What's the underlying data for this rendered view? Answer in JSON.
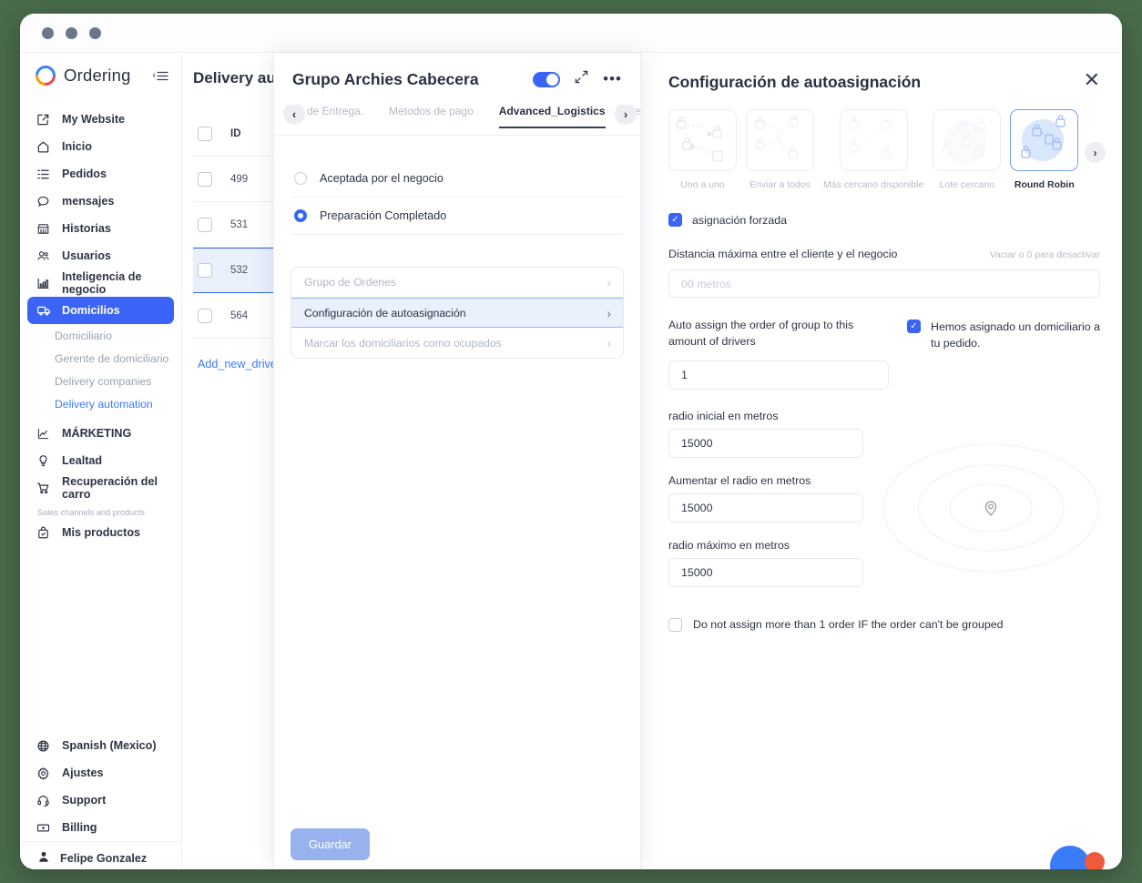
{
  "theme": {
    "accent": "#3b64f6",
    "link": "#3b7bf6",
    "desktop_bg": "#4a6b4c"
  },
  "sidebar": {
    "brand": "Ordering",
    "collapse_icon": "collapse-menu-icon",
    "items": [
      {
        "label": "My Website",
        "icon": "external-link-icon"
      },
      {
        "label": "Inicio",
        "icon": "home-icon"
      },
      {
        "label": "Pedidos",
        "icon": "list-icon"
      },
      {
        "label": "mensajes",
        "icon": "chat-bubble-icon"
      },
      {
        "label": "Historias",
        "icon": "store-icon"
      },
      {
        "label": "Usuarios",
        "icon": "users-icon"
      },
      {
        "label": "Inteligencia de negocio",
        "icon": "bar-chart-icon"
      },
      {
        "label": "Domicilios",
        "icon": "truck-icon",
        "active": true
      }
    ],
    "sub_items": [
      {
        "label": "Domiciliario",
        "selected": false
      },
      {
        "label": "Gerente de domiciliario",
        "selected": false
      },
      {
        "label": "Delivery companies",
        "selected": false
      },
      {
        "label": "Delivery automation",
        "selected": true
      }
    ],
    "items2": [
      {
        "label": "MÁRKETING",
        "icon": "trending-up-icon"
      },
      {
        "label": "Lealtad",
        "icon": "lightbulb-icon"
      },
      {
        "label": "Recuperación del carro",
        "icon": "shopping-cart-icon"
      }
    ],
    "group_label": "Sales channels and products",
    "items3": [
      {
        "label": "Mis productos",
        "icon": "bag-check-icon"
      }
    ],
    "bottom_items": [
      {
        "label": "Spanish (Mexico)",
        "icon": "globe-icon"
      },
      {
        "label": "Ajustes",
        "icon": "gear-icon"
      },
      {
        "label": "Support",
        "icon": "headset-icon"
      },
      {
        "label": "Billing",
        "icon": "banknote-icon"
      }
    ],
    "user": {
      "name": "Felipe Gonzalez",
      "icon": "avatar-icon"
    }
  },
  "table_panel": {
    "title": "Delivery au",
    "header": {
      "id": "ID"
    },
    "rows": [
      {
        "id": "499",
        "selected": false
      },
      {
        "id": "531",
        "selected": false
      },
      {
        "id": "532",
        "selected": true
      },
      {
        "id": "564",
        "selected": false
      }
    ],
    "add_link": "Add_new_drive"
  },
  "center_panel": {
    "title": "Grupo Archies Cabecera",
    "toggle_on": true,
    "expand_icon": "expand-arrows-icon",
    "more_icon": "ellipsis-icon",
    "tab_prev_icon": "chevron-left-icon",
    "tab_next_icon": "chevron-right-icon",
    "tabs": [
      {
        "label": "de Entrega.",
        "active": false
      },
      {
        "label": "Métodos de pago",
        "active": false
      },
      {
        "label": "Advanced_Logistics",
        "active": true
      },
      {
        "label": "registro",
        "active": false
      }
    ],
    "radios": [
      {
        "label": "Aceptada por el negocio",
        "selected": false
      },
      {
        "label": "Preparación Completado",
        "selected": true
      }
    ],
    "options": [
      {
        "label": "Grupo de Ordenes",
        "selected": false
      },
      {
        "label": "Configuración de autoasignación",
        "selected": true
      },
      {
        "label": "Marcar los domiciliarios como ocupados",
        "selected": false
      }
    ],
    "save_label": "Guardar"
  },
  "right_panel": {
    "title": "Configuración de autoasignación",
    "close_icon": "close-icon",
    "carousel_next_icon": "chevron-right-icon",
    "strategies": [
      {
        "label": "Uno a uno",
        "active": false
      },
      {
        "label": "Enviar a todos",
        "active": false
      },
      {
        "label": "Más cercano disponible",
        "active": false
      },
      {
        "label": "Lote cercano",
        "active": false
      },
      {
        "label": "Round Robin",
        "active": true
      }
    ],
    "forced_assignment": {
      "label": "asignación forzada",
      "checked": true
    },
    "max_distance": {
      "label": "Distancia máxima entre el cliente y el negocio",
      "hint": "Vaciar o 0 para desactivar",
      "value": "",
      "placeholder": "00 metros"
    },
    "auto_assign": {
      "label": "Auto assign the order of group to this amount of drivers",
      "value": "1"
    },
    "assigned_notice": {
      "label": "Hemos asignado un domiciliario a tu pedido.",
      "checked": true
    },
    "radius_fields": [
      {
        "label": "radio inicial en metros",
        "value": "15000"
      },
      {
        "label": "Aumentar el radio en metros",
        "value": "15000"
      },
      {
        "label": "radio máximo en metros",
        "value": "15000"
      }
    ],
    "map_icon": "map-pin-icon",
    "no_group_option": {
      "label": "Do not assign more than 1 order IF the order can't be grouped",
      "checked": false
    }
  },
  "chat_widget": {
    "icon": "chat-widget-icon"
  }
}
